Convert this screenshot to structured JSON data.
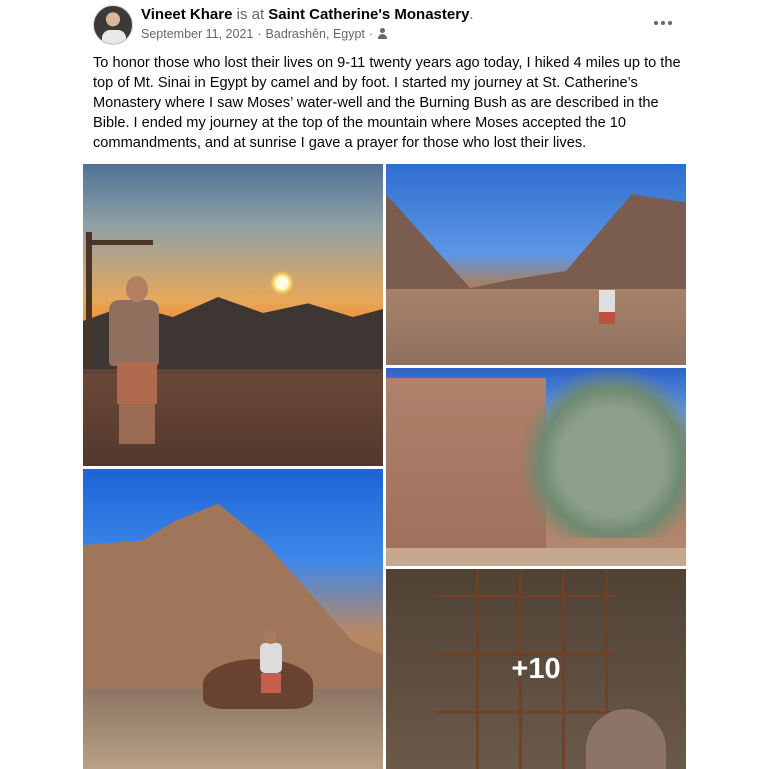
{
  "post": {
    "author": "Vineet Khare",
    "is_at": "is at",
    "place": "Saint Catherine's Monastery",
    "period": ".",
    "date": "September 11, 2021",
    "location": "Badrashên, Egypt",
    "separator": "·",
    "audience_icon": "friends-icon",
    "more_icon": "more-options-icon",
    "text": "To honor those who lost their lives on 9-11 twenty years ago today, I hiked 4 miles up to the top of Mt. Sinai in Egypt by camel and by foot. I started my journey at St. Catherine’s Monastery where I saw Moses’ water-well and the Burning Bush as are described in the Bible. I ended my journey at the top of the mountain where Moses accepted the 10 commandments, and at sunrise I gave a prayer for those who lost their lives."
  },
  "photos": {
    "more_count": "+10",
    "items": [
      {
        "name": "sunrise-photo"
      },
      {
        "name": "valley-photo"
      },
      {
        "name": "monastery-photo"
      },
      {
        "name": "mountain-photo"
      },
      {
        "name": "scaffold-photo"
      }
    ]
  }
}
